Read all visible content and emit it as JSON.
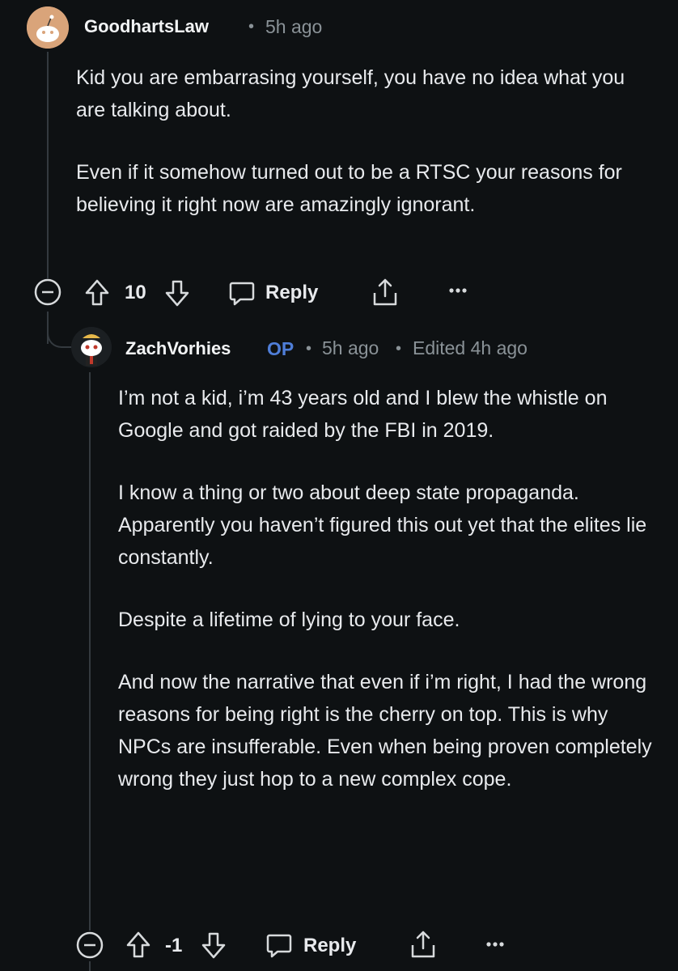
{
  "comment1": {
    "username": "GoodhartsLaw",
    "time": "5h ago",
    "paragraphs": [
      "Kid you are embarrasing yourself, you have no idea what you are talking about.",
      "Even if it somehow turned out to be a RTSC your reasons for believing it right now are amazingly ignorant."
    ],
    "votes": "10",
    "reply_label": "Reply"
  },
  "comment2": {
    "username": "ZachVorhies",
    "op_badge": "OP",
    "time": "5h ago",
    "edited": "Edited 4h ago",
    "paragraphs": [
      "I’m not a kid, i’m 43 years old and I blew the whistle on Google and got raided by the FBI in 2019.",
      "I know a thing or two about deep state propaganda. Apparently you haven’t figured this out yet that the elites lie constantly.",
      "Despite a lifetime of lying to your face.",
      "And now the narrative that even if i’m right, I had the wrong reasons for being right is the cherry on top. This is why NPCs are insufferable. Even when being proven completely wrong they just hop to a new complex cope."
    ],
    "votes": "-1",
    "reply_label": "Reply"
  },
  "icons": [
    "collapse-icon",
    "upvote-icon",
    "downvote-icon",
    "reply-icon",
    "share-icon",
    "more-icon"
  ],
  "colors": {
    "background": "#0e1113",
    "op": "#4f7ed8",
    "text": "#e8eaed",
    "meta": "#8a9297"
  }
}
